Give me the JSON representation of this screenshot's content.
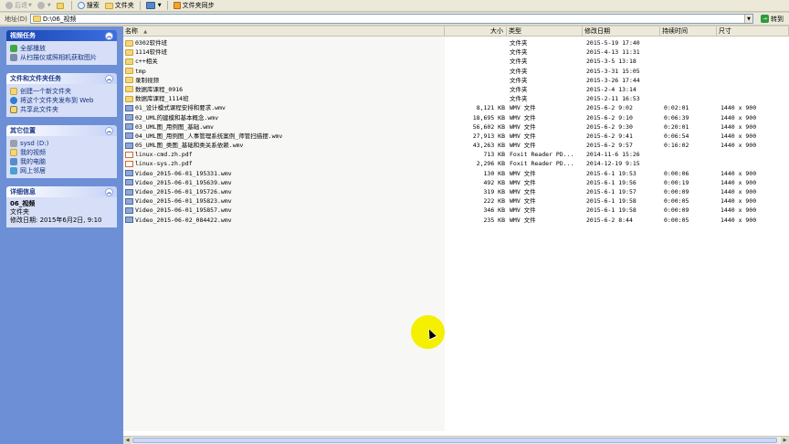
{
  "toolbar": {
    "back": "后退",
    "search": "搜索",
    "folders": "文件夹",
    "sync": "文件夹同步"
  },
  "address": {
    "label": "地址(D)",
    "path": "D:\\06_视频",
    "go": "转到"
  },
  "tasks": {
    "video": {
      "title": "视频任务",
      "items": [
        "全部播放",
        "从扫描仪或照相机获取图片"
      ]
    },
    "file": {
      "title": "文件和文件夹任务",
      "items": [
        "创建一个新文件夹",
        "将这个文件夹发布到 Web",
        "共享此文件夹"
      ]
    },
    "places": {
      "title": "其它位置",
      "items": [
        "sysd (D:)",
        "我的视频",
        "我的电脑",
        "网上邻居"
      ]
    },
    "details": {
      "title": "详细信息",
      "name": "06_视频",
      "type": "文件夹",
      "modified": "修改日期: 2015年6月2日, 9:10"
    }
  },
  "columns": {
    "name": "名称",
    "size": "大小",
    "type": "类型",
    "date": "修改日期",
    "duration": "持续时间",
    "dimensions": "尺寸"
  },
  "files": [
    {
      "icon": "folder",
      "name": "0302软件班",
      "size": "",
      "type": "文件夹",
      "date": "2015-5-19 17:40",
      "duration": "",
      "dimensions": ""
    },
    {
      "icon": "folder",
      "name": "1114软件班",
      "size": "",
      "type": "文件夹",
      "date": "2015-4-13 11:31",
      "duration": "",
      "dimensions": ""
    },
    {
      "icon": "folder",
      "name": "c++相关",
      "size": "",
      "type": "文件夹",
      "date": "2015-3-5 13:18",
      "duration": "",
      "dimensions": ""
    },
    {
      "icon": "folder",
      "name": "tmp",
      "size": "",
      "type": "文件夹",
      "date": "2015-3-31 15:05",
      "duration": "",
      "dimensions": ""
    },
    {
      "icon": "folder",
      "name": "录制视频",
      "size": "",
      "type": "文件夹",
      "date": "2015-3-26 17:44",
      "duration": "",
      "dimensions": ""
    },
    {
      "icon": "folder",
      "name": "数据库课程_0916",
      "size": "",
      "type": "文件夹",
      "date": "2015-2-4 13:14",
      "duration": "",
      "dimensions": ""
    },
    {
      "icon": "folder",
      "name": "数据库课程_1114班",
      "size": "",
      "type": "文件夹",
      "date": "2015-2-11 16:53",
      "duration": "",
      "dimensions": ""
    },
    {
      "icon": "video",
      "name": "01_设计模式课程安排和要求.wmv",
      "size": "8,121 KB",
      "type": "WMV 文件",
      "date": "2015-6-2 9:02",
      "duration": "0:02:01",
      "dimensions": "1440 x 900"
    },
    {
      "icon": "video",
      "name": "02_UML的建模和基本概念.wmv",
      "size": "18,695 KB",
      "type": "WMV 文件",
      "date": "2015-6-2 9:10",
      "duration": "0:06:39",
      "dimensions": "1440 x 900"
    },
    {
      "icon": "video",
      "name": "03_UML图_用例图_基础.wmv",
      "size": "56,602 KB",
      "type": "WMV 文件",
      "date": "2015-6-2 9:30",
      "duration": "0:20:01",
      "dimensions": "1440 x 900"
    },
    {
      "icon": "video",
      "name": "04_UML图_用例图_人事管理系统案例_师管扫描摆.wmv",
      "size": "27,913 KB",
      "type": "WMV 文件",
      "date": "2015-6-2 9:41",
      "duration": "0:06:54",
      "dimensions": "1440 x 900"
    },
    {
      "icon": "video",
      "name": "05_UML图_类图_基础和类关系依赖.wmv",
      "size": "43,263 KB",
      "type": "WMV 文件",
      "date": "2015-6-2 9:57",
      "duration": "0:16:02",
      "dimensions": "1440 x 900"
    },
    {
      "icon": "pdf",
      "name": "linux-cmd.zh.pdf",
      "size": "713 KB",
      "type": "Foxit Reader PD...",
      "date": "2014-11-6 15:26",
      "duration": "",
      "dimensions": ""
    },
    {
      "icon": "pdf",
      "name": "linux-sys.zh.pdf",
      "size": "2,296 KB",
      "type": "Foxit Reader PD...",
      "date": "2014-12-19 9:15",
      "duration": "",
      "dimensions": ""
    },
    {
      "icon": "video",
      "name": "Video_2015-06-01_195331.wmv",
      "size": "130 KB",
      "type": "WMV 文件",
      "date": "2015-6-1 19:53",
      "duration": "0:00:06",
      "dimensions": "1440 x 900"
    },
    {
      "icon": "video",
      "name": "Video_2015-06-01_195639.wmv",
      "size": "492 KB",
      "type": "WMV 文件",
      "date": "2015-6-1 19:56",
      "duration": "0:00:19",
      "dimensions": "1440 x 900"
    },
    {
      "icon": "video",
      "name": "Video_2015-06-01_195726.wmv",
      "size": "319 KB",
      "type": "WMV 文件",
      "date": "2015-6-1 19:57",
      "duration": "0:00:09",
      "dimensions": "1440 x 900"
    },
    {
      "icon": "video",
      "name": "Video_2015-06-01_195823.wmv",
      "size": "222 KB",
      "type": "WMV 文件",
      "date": "2015-6-1 19:58",
      "duration": "0:00:05",
      "dimensions": "1440 x 900"
    },
    {
      "icon": "video",
      "name": "Video_2015-06-01_195857.wmv",
      "size": "346 KB",
      "type": "WMV 文件",
      "date": "2015-6-1 19:58",
      "duration": "0:00:09",
      "dimensions": "1440 x 900"
    },
    {
      "icon": "video",
      "name": "Video_2015-06-02_084422.wmv",
      "size": "235 KB",
      "type": "WMV 文件",
      "date": "2015-6-2 8:44",
      "duration": "0:00:05",
      "dimensions": "1440 x 900"
    }
  ]
}
